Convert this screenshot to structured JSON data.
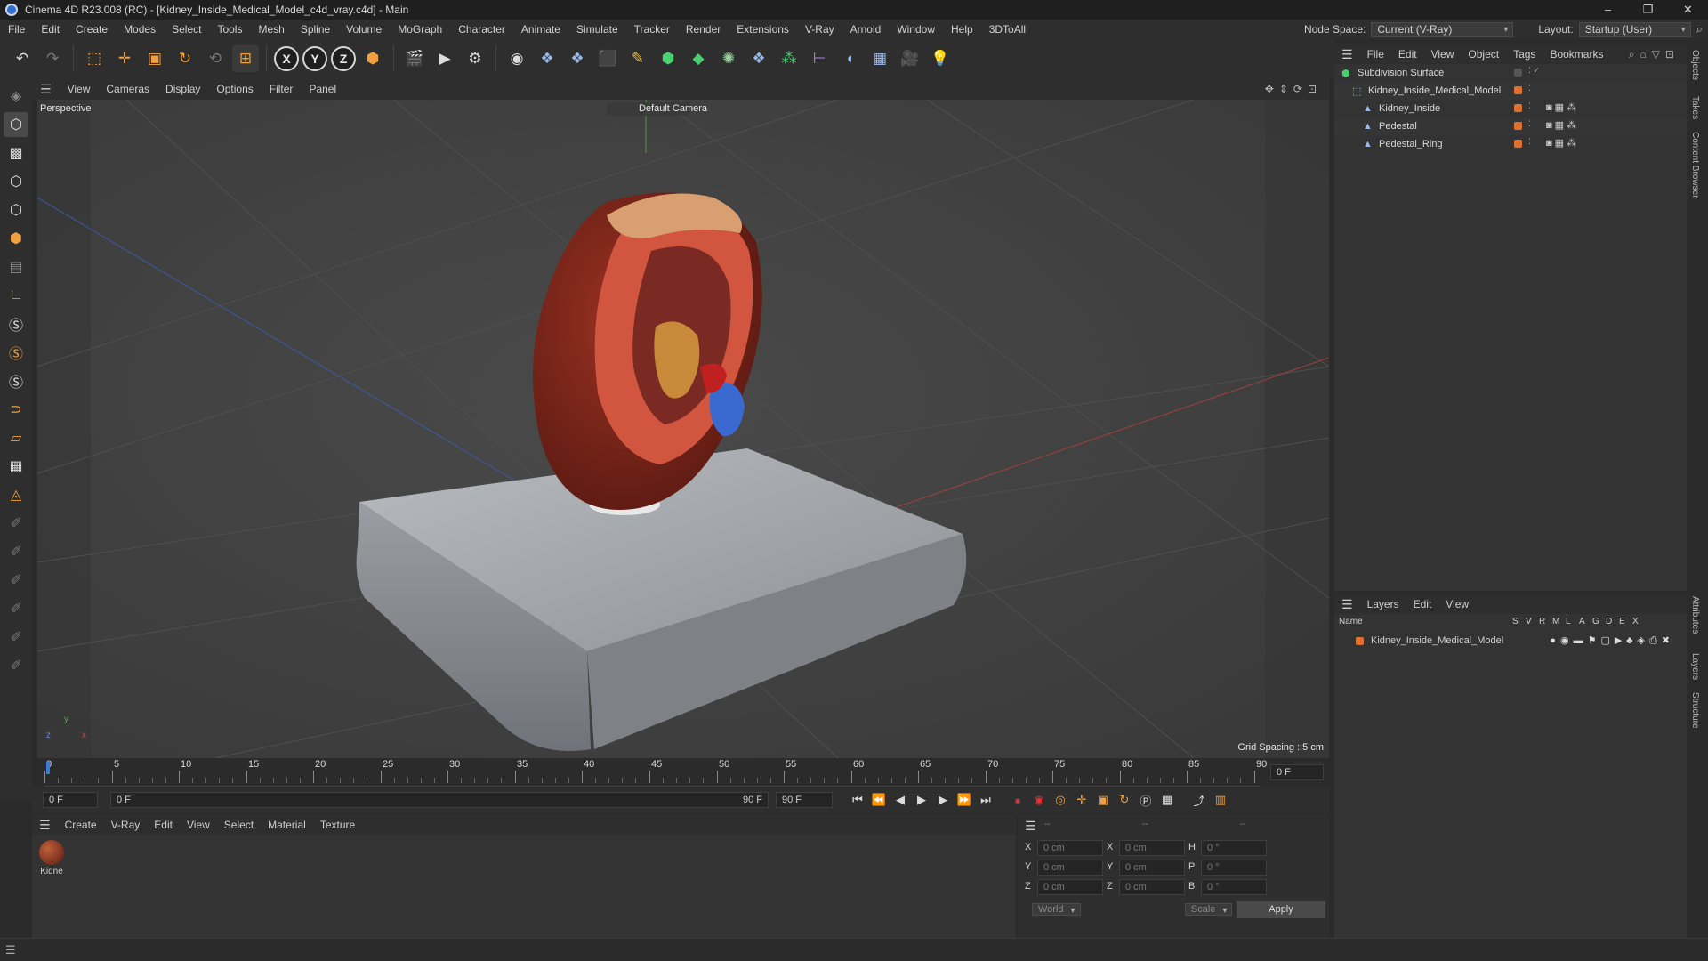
{
  "window": {
    "title": "Cinema 4D R23.008 (RC) - [Kidney_Inside_Medical_Model_c4d_vray.c4d] - Main",
    "controls": [
      "–",
      "❐",
      "✕"
    ]
  },
  "menubar": {
    "items": [
      "File",
      "Edit",
      "Create",
      "Modes",
      "Select",
      "Tools",
      "Mesh",
      "Spline",
      "Volume",
      "MoGraph",
      "Character",
      "Animate",
      "Simulate",
      "Tracker",
      "Render",
      "Extensions",
      "V-Ray",
      "Arnold",
      "Window",
      "Help",
      "3DToAll"
    ],
    "node_space_label": "Node Space:",
    "node_space_value": "Current (V-Ray)",
    "layout_label": "Layout:",
    "layout_value": "Startup (User)"
  },
  "viewport": {
    "menu": [
      "View",
      "Cameras",
      "Display",
      "Options",
      "Filter",
      "Panel"
    ],
    "view_name": "Perspective",
    "camera_label": "Default Camera",
    "grid_spacing": "Grid Spacing : 5 cm",
    "axis": {
      "y": "y",
      "z": "z",
      "x": "x"
    }
  },
  "timeline": {
    "ticks": [
      "0",
      "5",
      "10",
      "15",
      "20",
      "25",
      "30",
      "35",
      "40",
      "45",
      "50",
      "55",
      "60",
      "65",
      "70",
      "75",
      "80",
      "85",
      "90"
    ],
    "current_frame": "0 F",
    "start_field": "0 F",
    "range_start": "0 F",
    "range_end": "90 F",
    "end_field": "90 F"
  },
  "materials": {
    "menu": [
      "Create",
      "V-Ray",
      "Edit",
      "View",
      "Select",
      "Material",
      "Texture"
    ],
    "items": [
      {
        "label": "Kidne"
      }
    ]
  },
  "coords": {
    "header_left": "--",
    "header_mid": "--",
    "header_right": "--",
    "rows": [
      {
        "a": "X",
        "av": "0 cm",
        "b": "X",
        "bv": "0 cm",
        "c": "H",
        "cv": "0 °"
      },
      {
        "a": "Y",
        "av": "0 cm",
        "b": "Y",
        "bv": "0 cm",
        "c": "P",
        "cv": "0 °"
      },
      {
        "a": "Z",
        "av": "0 cm",
        "b": "Z",
        "bv": "0 cm",
        "c": "B",
        "cv": "0 °"
      }
    ],
    "mode": "World",
    "scale": "Scale",
    "apply": "Apply"
  },
  "objects": {
    "menu": [
      "File",
      "Edit",
      "View",
      "Object",
      "Tags",
      "Bookmarks"
    ],
    "tree": [
      {
        "name": "Subdivision Surface",
        "indent": 0
      },
      {
        "name": "Kidney_Inside_Medical_Model",
        "indent": 1
      },
      {
        "name": "Kidney_Inside",
        "indent": 2
      },
      {
        "name": "Pedestal",
        "indent": 2
      },
      {
        "name": "Pedestal_Ring",
        "indent": 2
      }
    ]
  },
  "layers": {
    "menu": [
      "Layers",
      "Edit",
      "View"
    ],
    "header_name": "Name",
    "header_cols": [
      "S",
      "V",
      "R",
      "M",
      "L",
      "A",
      "G",
      "D",
      "E",
      "X"
    ],
    "rows": [
      {
        "name": "Kidney_Inside_Medical_Model"
      }
    ]
  },
  "side_tabs": [
    "Objects",
    "Takes",
    "Content Browser",
    "Attributes",
    "Layers",
    "Structure"
  ],
  "colors": {
    "accent_orange": "#e07030",
    "axis_x": "#c04040",
    "axis_y": "#4a9a3a",
    "axis_z": "#3a6ad0"
  }
}
